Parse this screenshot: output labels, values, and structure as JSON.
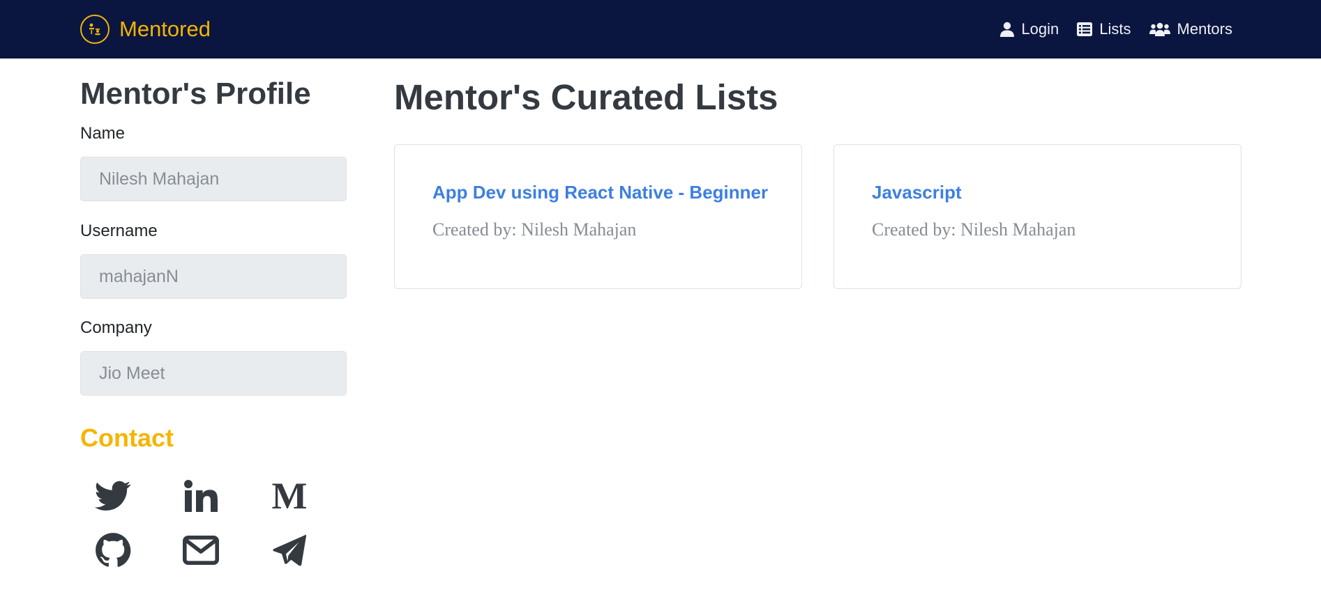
{
  "navbar": {
    "brand": "Mentored",
    "links": [
      {
        "label": "Login",
        "icon": "user-icon"
      },
      {
        "label": "Lists",
        "icon": "list-icon"
      },
      {
        "label": "Mentors",
        "icon": "users-icon"
      }
    ]
  },
  "profile": {
    "title": "Mentor's Profile",
    "fields": [
      {
        "label": "Name",
        "value": "Nilesh Mahajan"
      },
      {
        "label": "Username",
        "value": "mahajanN"
      },
      {
        "label": "Company",
        "value": "Jio Meet"
      }
    ],
    "contact_title": "Contact",
    "social": [
      "twitter-icon",
      "linkedin-icon",
      "medium-icon",
      "github-icon",
      "email-icon",
      "telegram-icon"
    ]
  },
  "main": {
    "title": "Mentor's Curated Lists",
    "cards": [
      {
        "title": "App Dev using React Native - Beginner",
        "created_by": "Created by: Nilesh Mahajan"
      },
      {
        "title": "Javascript",
        "created_by": "Created by: Nilesh Mahajan"
      }
    ]
  },
  "colors": {
    "navbar_bg": "#0b1640",
    "brand": "#f5b500",
    "link": "#3d7fe0",
    "field_bg": "#e9ecef",
    "icon": "#343a40"
  }
}
